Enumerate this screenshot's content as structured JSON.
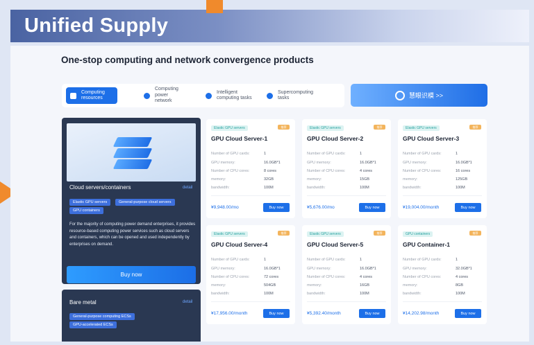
{
  "banner": {
    "title": "Unified Supply"
  },
  "heading": "One-stop computing and network convergence products",
  "tabs": [
    {
      "label": "Computing resources"
    },
    {
      "label": "Computing power network"
    },
    {
      "label": "Intelligent computing tasks"
    },
    {
      "label": "Supercomputing tasks"
    }
  ],
  "promo": {
    "label": "慧眼识模 >>"
  },
  "left_panel": {
    "title": "Cloud servers/containers",
    "detail": "detail",
    "chips": [
      "Elastic GPU servers",
      "General-purpose cloud servers",
      "GPU containers"
    ],
    "description": "For the majority of computing power demand enterprises, it provides resource-based computing power services such as cloud servers and containers, which can be opened and used independently by enterprises on demand.",
    "buy_label": "Buy now"
  },
  "bare_metal": {
    "title": "Bare metal",
    "detail": "detail",
    "chips": [
      "General-purpose computing ECSs",
      "GPU-accelerated ECSs"
    ]
  },
  "spec_labels": [
    "Number of GPU cards:",
    "GPU memory:",
    "Number of CPU cores:",
    "memory:",
    "bandwidth:"
  ],
  "products": [
    {
      "tag": "Elastic GPU servers",
      "badge": "推荐",
      "name": "GPU Cloud Server-1",
      "values": [
        "1",
        "16.0GB*1",
        "8 cores",
        "32GB",
        "100M"
      ],
      "price": "¥9,948.00/mo",
      "buy": "Buy now"
    },
    {
      "tag": "Elastic GPU servers",
      "badge": "推荐",
      "name": "GPU Cloud Server-2",
      "values": [
        "1",
        "16.0GB*1",
        "4 cores",
        "15GB",
        "100M"
      ],
      "price": "¥5,676.00/mo",
      "buy": "Buy now"
    },
    {
      "tag": "Elastic GPU servers",
      "badge": "推荐",
      "name": "GPU Cloud Server-3",
      "values": [
        "1",
        "16.0GB*1",
        "16 cores",
        "125GB",
        "100M"
      ],
      "price": "¥19,004.00/month",
      "buy": "Buy now"
    },
    {
      "tag": "Elastic GPU servers",
      "badge": "推荐",
      "name": "GPU Cloud Server-4",
      "values": [
        "1",
        "16.0GB*1",
        "72 cores",
        "504GB",
        "100M"
      ],
      "price": "¥17,956.00/month",
      "buy": "Buy now"
    },
    {
      "tag": "Elastic GPU servers",
      "badge": "推荐",
      "name": "GPU Cloud Server-5",
      "values": [
        "1",
        "16.0GB*1",
        "4 cores",
        "16GB",
        "100M"
      ],
      "price": "¥5,392.40/month",
      "buy": "Buy now"
    },
    {
      "tag": "GPU containers",
      "badge": "推荐",
      "name": "GPU Container-1",
      "values": [
        "1",
        "32.0GB*1",
        "4 cores",
        "8GB",
        "100M"
      ],
      "price": "¥14,202.98/month",
      "buy": "Buy now"
    }
  ]
}
